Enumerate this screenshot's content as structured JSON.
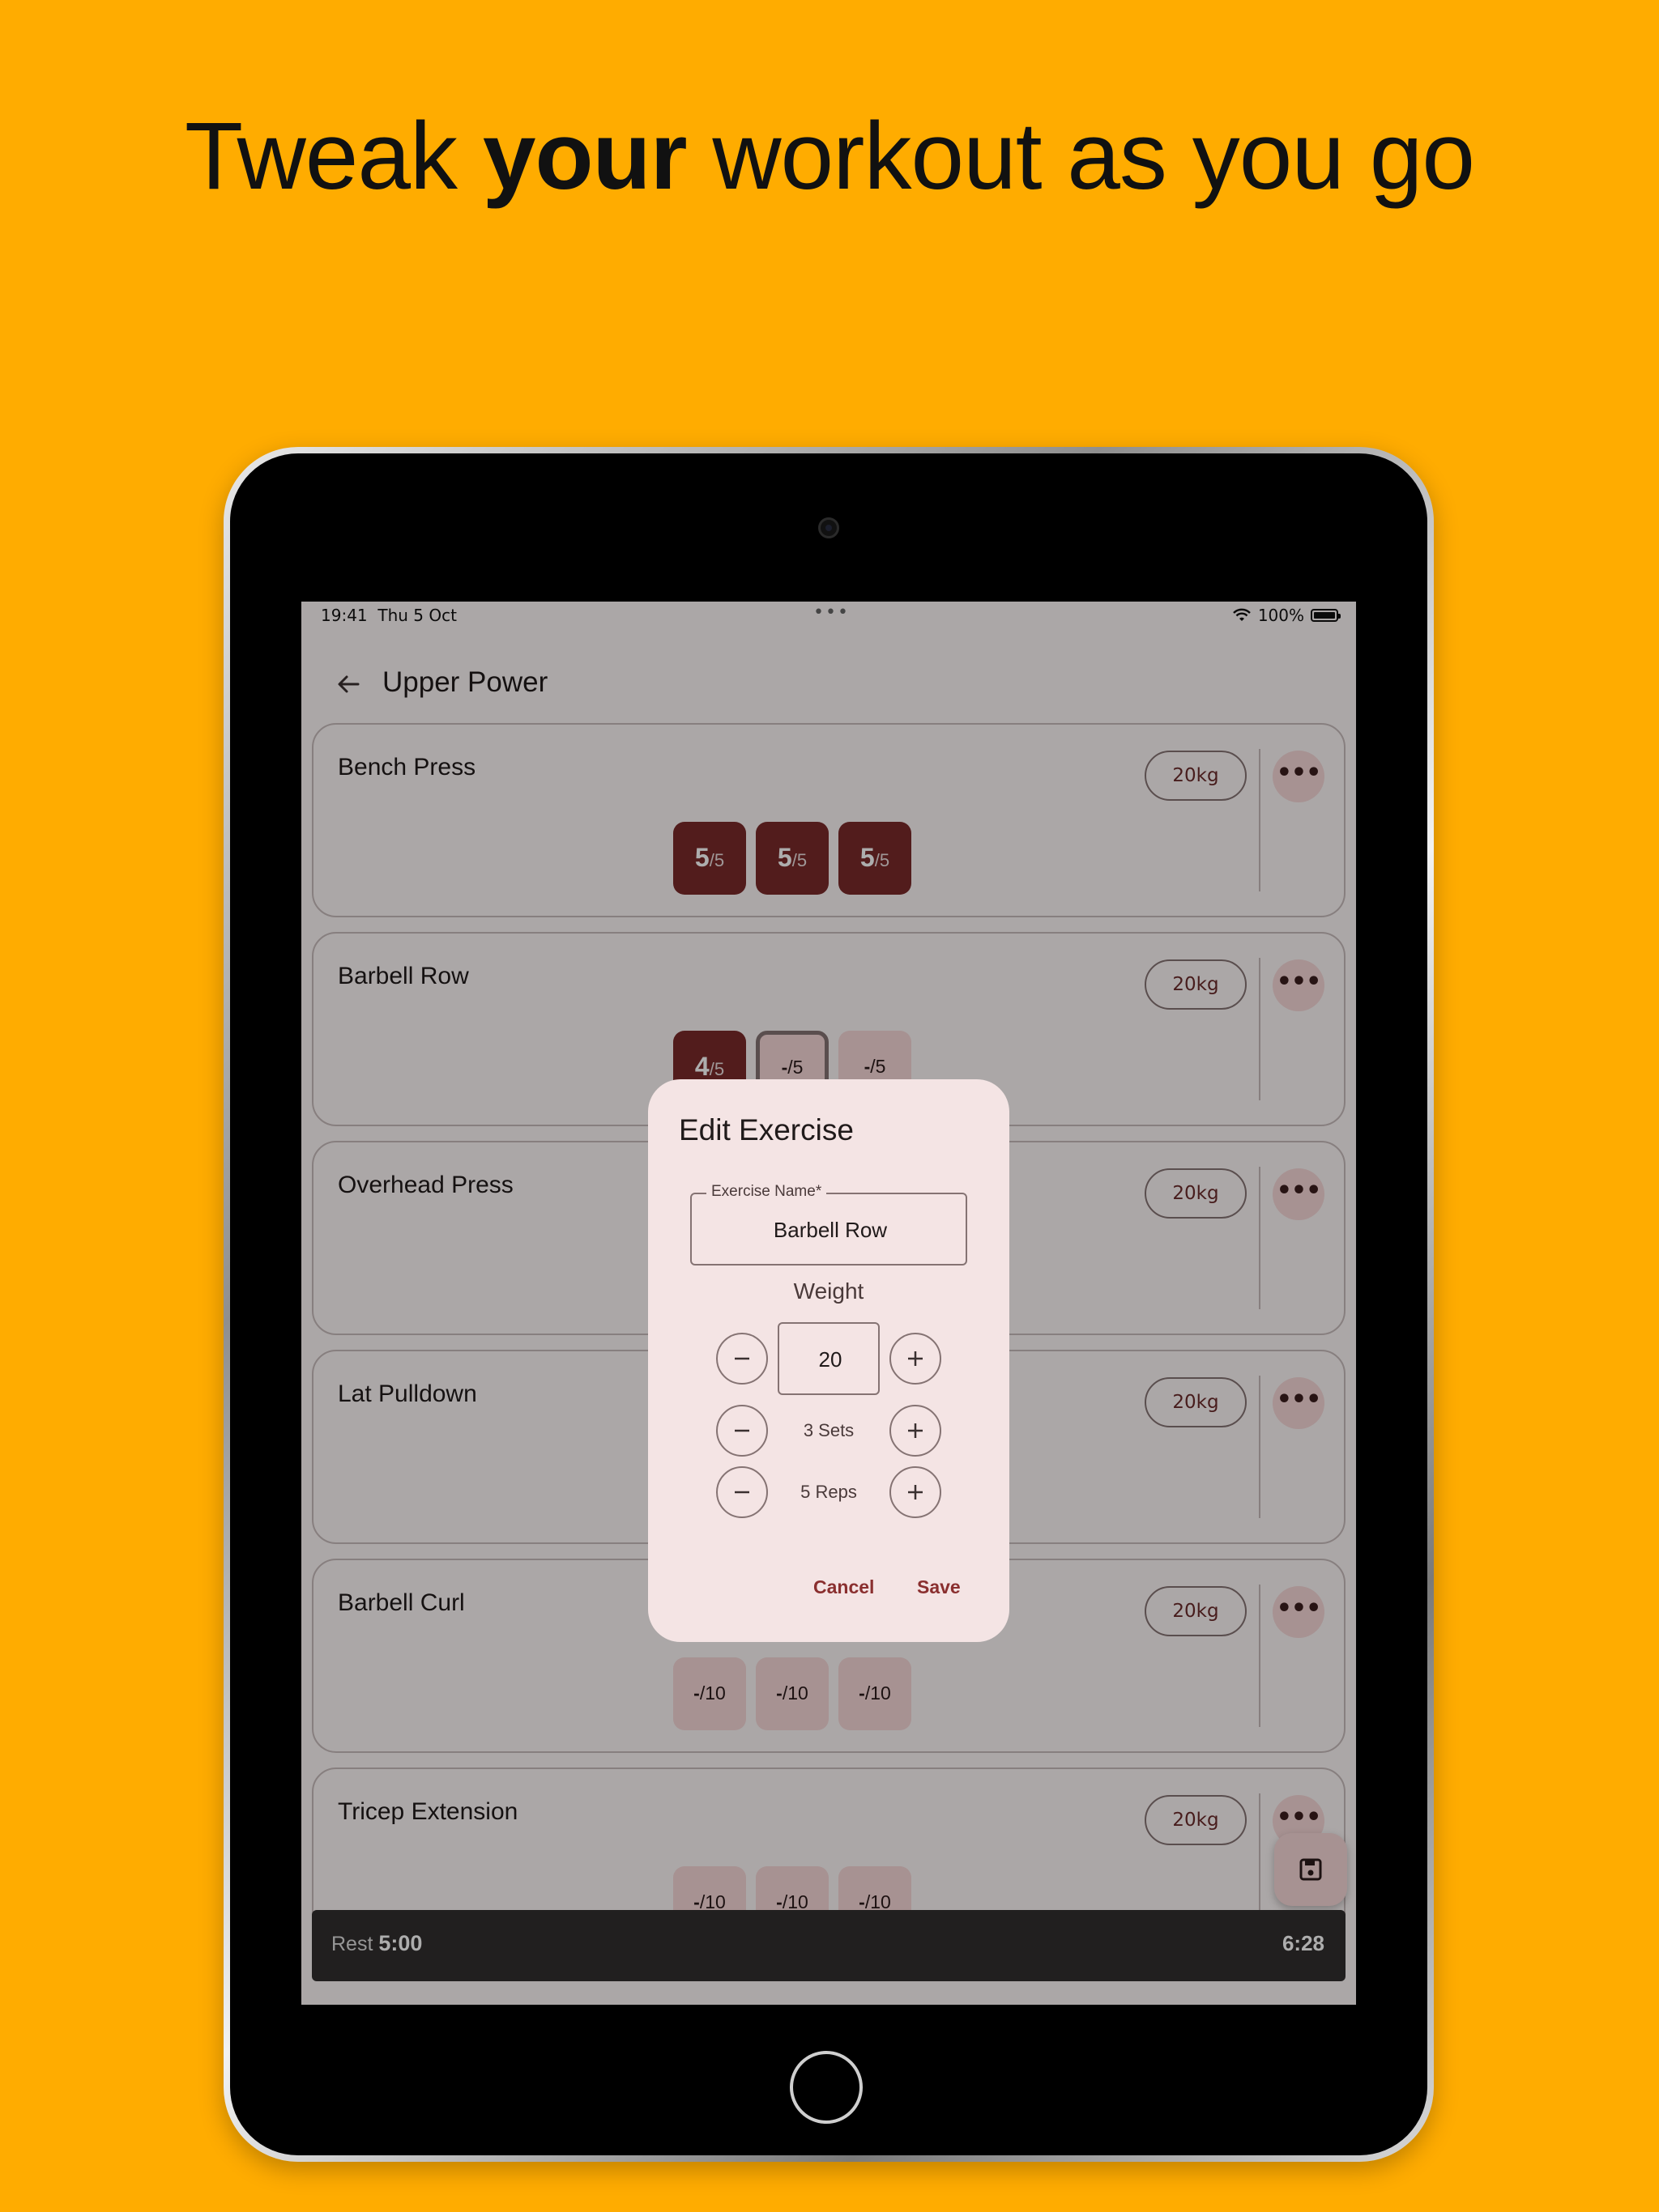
{
  "headline": {
    "before": "Tweak ",
    "bold": "your",
    "after": " workout as you go"
  },
  "status_bar": {
    "time": "19:41",
    "date": "Thu 5 Oct",
    "dots": "•••",
    "battery": "100%"
  },
  "app_bar": {
    "title": "Upper Power",
    "back_icon": "arrow-left-icon"
  },
  "exercises": [
    {
      "name": "Bench Press",
      "weight": "20kg",
      "more": "•••",
      "sets": [
        {
          "reps": "5",
          "target": "/5",
          "state": "done"
        },
        {
          "reps": "5",
          "target": "/5",
          "state": "done"
        },
        {
          "reps": "5",
          "target": "/5",
          "state": "done"
        }
      ]
    },
    {
      "name": "Barbell Row",
      "weight": "20kg",
      "more": "•••",
      "sets": [
        {
          "reps": "4",
          "target": "/5",
          "state": "done"
        },
        {
          "reps": "-",
          "target": "/5",
          "state": "active"
        },
        {
          "reps": "-",
          "target": "/5",
          "state": "todo"
        }
      ]
    },
    {
      "name": "Overhead Press",
      "weight": "20kg",
      "more": "•••",
      "sets": []
    },
    {
      "name": "Lat Pulldown",
      "weight": "20kg",
      "more": "•••",
      "sets": []
    },
    {
      "name": "Barbell Curl",
      "weight": "20kg",
      "more": "•••",
      "sets": [
        {
          "reps": "-",
          "target": "/10",
          "state": "todo"
        },
        {
          "reps": "-",
          "target": "/10",
          "state": "todo"
        },
        {
          "reps": "-",
          "target": "/10",
          "state": "todo"
        }
      ]
    },
    {
      "name": "Tricep Extension",
      "weight": "20kg",
      "more": "•••",
      "sets": [
        {
          "reps": "-",
          "target": "/10",
          "state": "todo"
        },
        {
          "reps": "-",
          "target": "/10",
          "state": "todo"
        },
        {
          "reps": "-",
          "target": "/10",
          "state": "todo"
        }
      ]
    }
  ],
  "rest_bar": {
    "label": "Rest",
    "rest_time": "5:00",
    "elapsed": "6:28"
  },
  "fab": {
    "icon": "save-icon"
  },
  "dialog": {
    "title": "Edit Exercise",
    "name_label": "Exercise Name*",
    "name_value": "Barbell Row",
    "weight_label": "Weight",
    "weight_value": "20",
    "sets_value": "3 Sets",
    "reps_value": "5 Reps",
    "cancel": "Cancel",
    "save": "Save"
  },
  "colors": {
    "background": "#FFAC00",
    "accent": "#7A2A2A",
    "container": "#F6D7D7"
  }
}
